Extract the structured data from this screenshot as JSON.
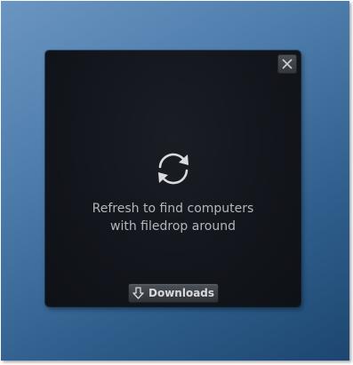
{
  "window": {
    "close_icon": "close-icon",
    "refresh_icon": "refresh-icon",
    "message_line1": "Refresh to find computers",
    "message_line2": "with filedrop around",
    "downloads_label": "Downloads",
    "downloads_icon": "download-arrow-icon"
  },
  "colors": {
    "desktop_background": "#3f6e9d",
    "panel_background": "#14171d",
    "message_text": "#b3b6bb",
    "button_background": "#3d4047"
  }
}
